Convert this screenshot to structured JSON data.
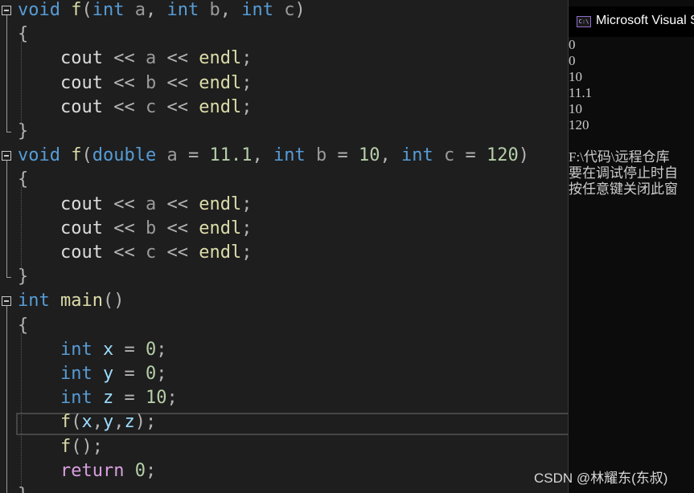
{
  "editor": {
    "lines": [
      [
        {
          "t": "void",
          "c": "kw"
        },
        {
          "t": " ",
          "c": "plain"
        },
        {
          "t": "f",
          "c": "fn"
        },
        {
          "t": "(",
          "c": "op"
        },
        {
          "t": "int",
          "c": "kw"
        },
        {
          "t": " ",
          "c": "plain"
        },
        {
          "t": "a",
          "c": "param"
        },
        {
          "t": ", ",
          "c": "op"
        },
        {
          "t": "int",
          "c": "kw"
        },
        {
          "t": " ",
          "c": "plain"
        },
        {
          "t": "b",
          "c": "param"
        },
        {
          "t": ", ",
          "c": "op"
        },
        {
          "t": "int",
          "c": "kw"
        },
        {
          "t": " ",
          "c": "plain"
        },
        {
          "t": "c",
          "c": "param"
        },
        {
          "t": ")",
          "c": "op"
        }
      ],
      [
        {
          "t": "{",
          "c": "op"
        }
      ],
      [
        {
          "t": "    cout ",
          "c": "plain"
        },
        {
          "t": "<<",
          "c": "op"
        },
        {
          "t": " ",
          "c": "plain"
        },
        {
          "t": "a",
          "c": "param"
        },
        {
          "t": " ",
          "c": "plain"
        },
        {
          "t": "<<",
          "c": "op"
        },
        {
          "t": " ",
          "c": "plain"
        },
        {
          "t": "endl",
          "c": "fn"
        },
        {
          "t": ";",
          "c": "op"
        }
      ],
      [
        {
          "t": "    cout ",
          "c": "plain"
        },
        {
          "t": "<<",
          "c": "op"
        },
        {
          "t": " ",
          "c": "plain"
        },
        {
          "t": "b",
          "c": "param"
        },
        {
          "t": " ",
          "c": "plain"
        },
        {
          "t": "<<",
          "c": "op"
        },
        {
          "t": " ",
          "c": "plain"
        },
        {
          "t": "endl",
          "c": "fn"
        },
        {
          "t": ";",
          "c": "op"
        }
      ],
      [
        {
          "t": "    cout ",
          "c": "plain"
        },
        {
          "t": "<<",
          "c": "op"
        },
        {
          "t": " ",
          "c": "plain"
        },
        {
          "t": "c",
          "c": "param"
        },
        {
          "t": " ",
          "c": "plain"
        },
        {
          "t": "<<",
          "c": "op"
        },
        {
          "t": " ",
          "c": "plain"
        },
        {
          "t": "endl",
          "c": "fn"
        },
        {
          "t": ";",
          "c": "op"
        }
      ],
      [
        {
          "t": "}",
          "c": "op"
        }
      ],
      [
        {
          "t": "void",
          "c": "kw"
        },
        {
          "t": " ",
          "c": "plain"
        },
        {
          "t": "f",
          "c": "fn"
        },
        {
          "t": "(",
          "c": "op"
        },
        {
          "t": "double",
          "c": "kw"
        },
        {
          "t": " ",
          "c": "plain"
        },
        {
          "t": "a",
          "c": "param"
        },
        {
          "t": " = ",
          "c": "op"
        },
        {
          "t": "11.1",
          "c": "num"
        },
        {
          "t": ", ",
          "c": "op"
        },
        {
          "t": "int",
          "c": "kw"
        },
        {
          "t": " ",
          "c": "plain"
        },
        {
          "t": "b",
          "c": "param"
        },
        {
          "t": " = ",
          "c": "op"
        },
        {
          "t": "10",
          "c": "num"
        },
        {
          "t": ", ",
          "c": "op"
        },
        {
          "t": "int",
          "c": "kw"
        },
        {
          "t": " ",
          "c": "plain"
        },
        {
          "t": "c",
          "c": "param"
        },
        {
          "t": " = ",
          "c": "op"
        },
        {
          "t": "120",
          "c": "num"
        },
        {
          "t": ")",
          "c": "op"
        }
      ],
      [
        {
          "t": "{",
          "c": "op"
        }
      ],
      [
        {
          "t": "    cout ",
          "c": "plain"
        },
        {
          "t": "<<",
          "c": "op"
        },
        {
          "t": " ",
          "c": "plain"
        },
        {
          "t": "a",
          "c": "param"
        },
        {
          "t": " ",
          "c": "plain"
        },
        {
          "t": "<<",
          "c": "op"
        },
        {
          "t": " ",
          "c": "plain"
        },
        {
          "t": "endl",
          "c": "fn"
        },
        {
          "t": ";",
          "c": "op"
        }
      ],
      [
        {
          "t": "    cout ",
          "c": "plain"
        },
        {
          "t": "<<",
          "c": "op"
        },
        {
          "t": " ",
          "c": "plain"
        },
        {
          "t": "b",
          "c": "param"
        },
        {
          "t": " ",
          "c": "plain"
        },
        {
          "t": "<<",
          "c": "op"
        },
        {
          "t": " ",
          "c": "plain"
        },
        {
          "t": "endl",
          "c": "fn"
        },
        {
          "t": ";",
          "c": "op"
        }
      ],
      [
        {
          "t": "    cout ",
          "c": "plain"
        },
        {
          "t": "<<",
          "c": "op"
        },
        {
          "t": " ",
          "c": "plain"
        },
        {
          "t": "c",
          "c": "param"
        },
        {
          "t": " ",
          "c": "plain"
        },
        {
          "t": "<<",
          "c": "op"
        },
        {
          "t": " ",
          "c": "plain"
        },
        {
          "t": "endl",
          "c": "fn"
        },
        {
          "t": ";",
          "c": "op"
        }
      ],
      [
        {
          "t": "}",
          "c": "op"
        }
      ],
      [
        {
          "t": "int",
          "c": "kw"
        },
        {
          "t": " ",
          "c": "plain"
        },
        {
          "t": "main",
          "c": "fn"
        },
        {
          "t": "()",
          "c": "op"
        }
      ],
      [
        {
          "t": "{",
          "c": "op"
        }
      ],
      [
        {
          "t": "    ",
          "c": "plain"
        },
        {
          "t": "int",
          "c": "kw"
        },
        {
          "t": " ",
          "c": "plain"
        },
        {
          "t": "x",
          "c": "var"
        },
        {
          "t": " = ",
          "c": "op"
        },
        {
          "t": "0",
          "c": "num"
        },
        {
          "t": ";",
          "c": "op"
        }
      ],
      [
        {
          "t": "    ",
          "c": "plain"
        },
        {
          "t": "int",
          "c": "kw"
        },
        {
          "t": " ",
          "c": "plain"
        },
        {
          "t": "y",
          "c": "var"
        },
        {
          "t": " = ",
          "c": "op"
        },
        {
          "t": "0",
          "c": "num"
        },
        {
          "t": ";",
          "c": "op"
        }
      ],
      [
        {
          "t": "    ",
          "c": "plain"
        },
        {
          "t": "int",
          "c": "kw"
        },
        {
          "t": " ",
          "c": "plain"
        },
        {
          "t": "z",
          "c": "var"
        },
        {
          "t": " = ",
          "c": "op"
        },
        {
          "t": "10",
          "c": "num"
        },
        {
          "t": ";",
          "c": "op"
        }
      ],
      [
        {
          "t": "    ",
          "c": "plain"
        },
        {
          "t": "f",
          "c": "fn"
        },
        {
          "t": "(",
          "c": "op"
        },
        {
          "t": "x",
          "c": "var"
        },
        {
          "t": ",",
          "c": "op"
        },
        {
          "t": "y",
          "c": "var"
        },
        {
          "t": ",",
          "c": "op"
        },
        {
          "t": "z",
          "c": "var"
        },
        {
          "t": ");",
          "c": "op"
        }
      ],
      [
        {
          "t": "    ",
          "c": "plain"
        },
        {
          "t": "f",
          "c": "fn"
        },
        {
          "t": "();",
          "c": "op"
        }
      ],
      [
        {
          "t": "    ",
          "c": "plain"
        },
        {
          "t": "return",
          "c": "kw2"
        },
        {
          "t": " ",
          "c": "plain"
        },
        {
          "t": "0",
          "c": "num"
        },
        {
          "t": ";",
          "c": "op"
        }
      ],
      [
        {
          "t": "}",
          "c": "op"
        }
      ]
    ]
  },
  "console": {
    "title": "Microsoft Visual S",
    "icon_label": "C:\\",
    "output": [
      "0",
      "0",
      "10",
      "11.1",
      "10",
      "120",
      "",
      "F:\\代码\\远程仓库",
      "要在调试停止时自",
      "按任意键关闭此窗"
    ]
  },
  "watermark": "CSDN @林耀东(东叔)"
}
